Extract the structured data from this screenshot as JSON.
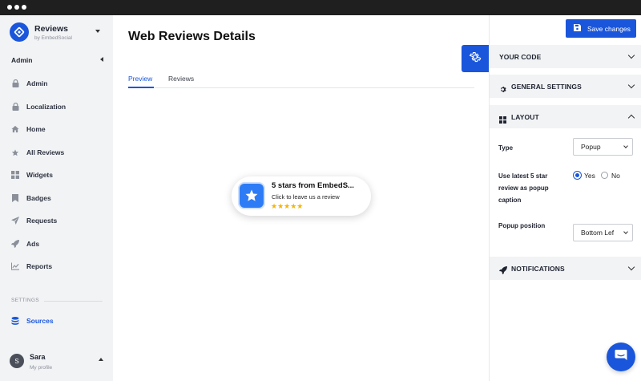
{
  "window": {
    "title": ""
  },
  "sidebar": {
    "brand": {
      "title": "Reviews",
      "subtitle": "by EmbedSocial"
    },
    "section_title": "Admin",
    "items": [
      {
        "label": "Admin",
        "icon": "lock-icon"
      },
      {
        "label": "Localization",
        "icon": "lock-icon"
      },
      {
        "label": "Home",
        "icon": "home-icon"
      },
      {
        "label": "All Reviews",
        "icon": "star-icon"
      },
      {
        "label": "Widgets",
        "icon": "widgets-icon"
      },
      {
        "label": "Badges",
        "icon": "bookmark-icon"
      },
      {
        "label": "Requests",
        "icon": "send-icon"
      },
      {
        "label": "Ads",
        "icon": "rocket-icon"
      },
      {
        "label": "Reports",
        "icon": "chart-icon"
      }
    ],
    "settings_header": "SETTINGS",
    "sources_label": "Sources",
    "user": {
      "initial": "S",
      "name": "Sara",
      "subtitle": "My profile"
    }
  },
  "main": {
    "title": "Web Reviews Details",
    "tabs": [
      {
        "label": "Preview",
        "active": true
      },
      {
        "label": "Reviews",
        "active": false
      }
    ],
    "widget": {
      "title": "5 stars from EmbedS...",
      "subtitle": "Click to leave us a review",
      "stars": "★★★★★"
    }
  },
  "panel": {
    "save_label": "Save changes",
    "sections": {
      "your_code": "YOUR CODE",
      "general": "GENERAL SETTINGS",
      "layout": "LAYOUT",
      "notifications": "NOTIFICATIONS"
    },
    "layout": {
      "type_label": "Type",
      "type_value": "Popup",
      "latest_label": "Use latest 5 star review as popup caption",
      "radio_yes": "Yes",
      "radio_no": "No",
      "position_label": "Popup position",
      "position_value": "Bottom Lef"
    }
  },
  "colors": {
    "accent": "#1a56db",
    "sidebar_bg": "#f2f3f5",
    "star": "#f5b400"
  }
}
